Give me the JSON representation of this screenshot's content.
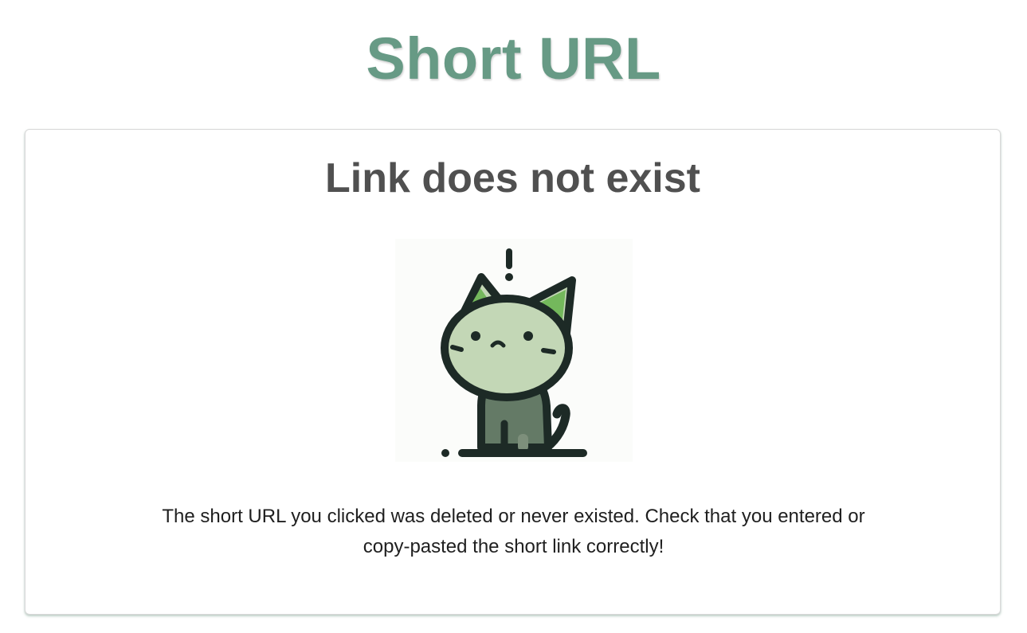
{
  "header": {
    "title": "Short URL"
  },
  "card": {
    "heading": "Link does not exist",
    "illustration_icon": "confused-cat-icon",
    "message": "The short URL you clicked was deleted or never existed. Check that you entered or copy-pasted the short link correctly!"
  },
  "colors": {
    "brand": "#679a85",
    "heading_text": "#505050",
    "body_text": "#1f1f1f",
    "cat_face": "#c3d7b6",
    "cat_body": "#647a66",
    "cat_ear_inner": "#74b85c",
    "outline": "#1d2a26"
  }
}
